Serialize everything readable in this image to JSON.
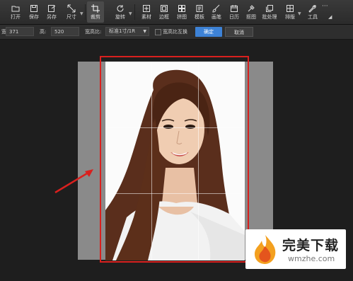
{
  "toolbar": {
    "items": [
      {
        "label": "打开",
        "icon": "folder-open-icon"
      },
      {
        "label": "保存",
        "icon": "save-icon"
      },
      {
        "label": "另存",
        "icon": "save-as-icon"
      },
      {
        "label": "尺寸",
        "icon": "resize-icon"
      },
      {
        "label": "裁剪",
        "icon": "crop-icon"
      },
      {
        "label": "旋转",
        "icon": "rotate-icon"
      },
      {
        "label": "素材",
        "icon": "material-icon"
      },
      {
        "label": "边框",
        "icon": "frame-icon"
      },
      {
        "label": "拼图",
        "icon": "collage-icon"
      },
      {
        "label": "模板",
        "icon": "template-icon"
      },
      {
        "label": "画笔",
        "icon": "brush-icon"
      },
      {
        "label": "日历",
        "icon": "calendar-icon"
      },
      {
        "label": "抠图",
        "icon": "cutout-icon"
      },
      {
        "label": "批处理",
        "icon": "batch-icon"
      },
      {
        "label": "排版",
        "icon": "layout-icon"
      },
      {
        "label": "工具",
        "icon": "wrench-icon"
      }
    ],
    "more": "···"
  },
  "options": {
    "width_label": "宽:",
    "width_value": "371",
    "height_label": "高:",
    "height_value": "520",
    "ratio_label": "宽高比:",
    "ratio_value": "标准1寸/1R",
    "swap_label": "宽高比互换",
    "confirm": "确定",
    "cancel": "取消"
  },
  "watermark": {
    "title": "完美下载",
    "sub": "wmzhe.com"
  },
  "colors": {
    "accent": "#3d82d6",
    "crop_frame": "#d9201e",
    "arrow": "#d9201e"
  }
}
